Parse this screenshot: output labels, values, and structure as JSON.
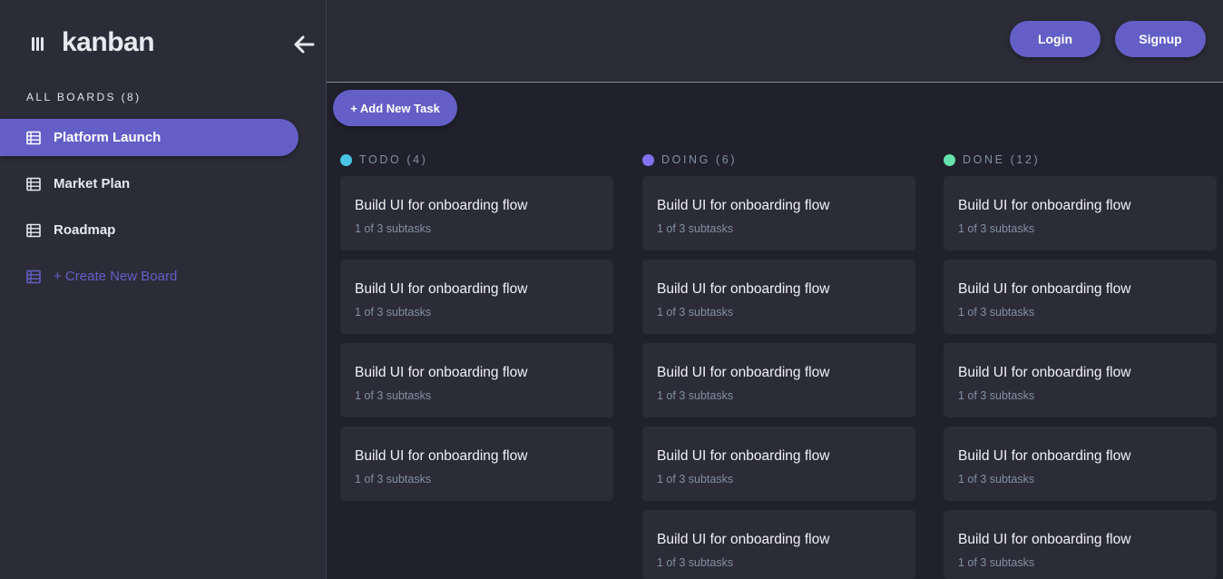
{
  "app": {
    "logo_text": "kanban",
    "icons": {
      "logo": "kanban-logo-icon",
      "collapse": "arrow-left-icon",
      "board": "board-table-icon"
    }
  },
  "sidebar": {
    "heading": "ALL BOARDS (8)",
    "boards": [
      {
        "label": "Platform Launch",
        "active": true
      },
      {
        "label": "Market Plan",
        "active": false
      },
      {
        "label": "Roadmap",
        "active": false
      }
    ],
    "create_label": "+ Create New Board"
  },
  "header": {
    "login_label": "Login",
    "signup_label": "Signup"
  },
  "board": {
    "add_task_label": "+ Add New Task",
    "columns": [
      {
        "title": "TODO (4)",
        "dot_color": "#49c4e5",
        "tasks": [
          {
            "title": "Build UI for onboarding flow",
            "subtasks": "1 of 3 subtasks"
          },
          {
            "title": "Build UI for onboarding flow",
            "subtasks": "1 of 3 subtasks"
          },
          {
            "title": "Build UI for onboarding flow",
            "subtasks": "1 of 3 subtasks"
          },
          {
            "title": "Build UI for onboarding flow",
            "subtasks": "1 of 3 subtasks"
          }
        ]
      },
      {
        "title": "DOING (6)",
        "dot_color": "#8471f2",
        "tasks": [
          {
            "title": "Build UI for onboarding flow",
            "subtasks": "1 of 3 subtasks"
          },
          {
            "title": "Build UI for onboarding flow",
            "subtasks": "1 of 3 subtasks"
          },
          {
            "title": "Build UI for onboarding flow",
            "subtasks": "1 of 3 subtasks"
          },
          {
            "title": "Build UI for onboarding flow",
            "subtasks": "1 of 3 subtasks"
          },
          {
            "title": "Build UI for onboarding flow",
            "subtasks": "1 of 3 subtasks"
          }
        ]
      },
      {
        "title": "DONE (12)",
        "dot_color": "#67e2ae",
        "tasks": [
          {
            "title": "Build UI for onboarding flow",
            "subtasks": "1 of 3 subtasks"
          },
          {
            "title": "Build UI for onboarding flow",
            "subtasks": "1 of 3 subtasks"
          },
          {
            "title": "Build UI for onboarding flow",
            "subtasks": "1 of 3 subtasks"
          },
          {
            "title": "Build UI for onboarding flow",
            "subtasks": "1 of 3 subtasks"
          },
          {
            "title": "Build UI for onboarding flow",
            "subtasks": "1 of 3 subtasks"
          }
        ]
      }
    ]
  },
  "colors": {
    "accent": "#635fc7",
    "background": "#20212c",
    "panel": "#2b2c37",
    "muted_text": "#828fa3"
  }
}
